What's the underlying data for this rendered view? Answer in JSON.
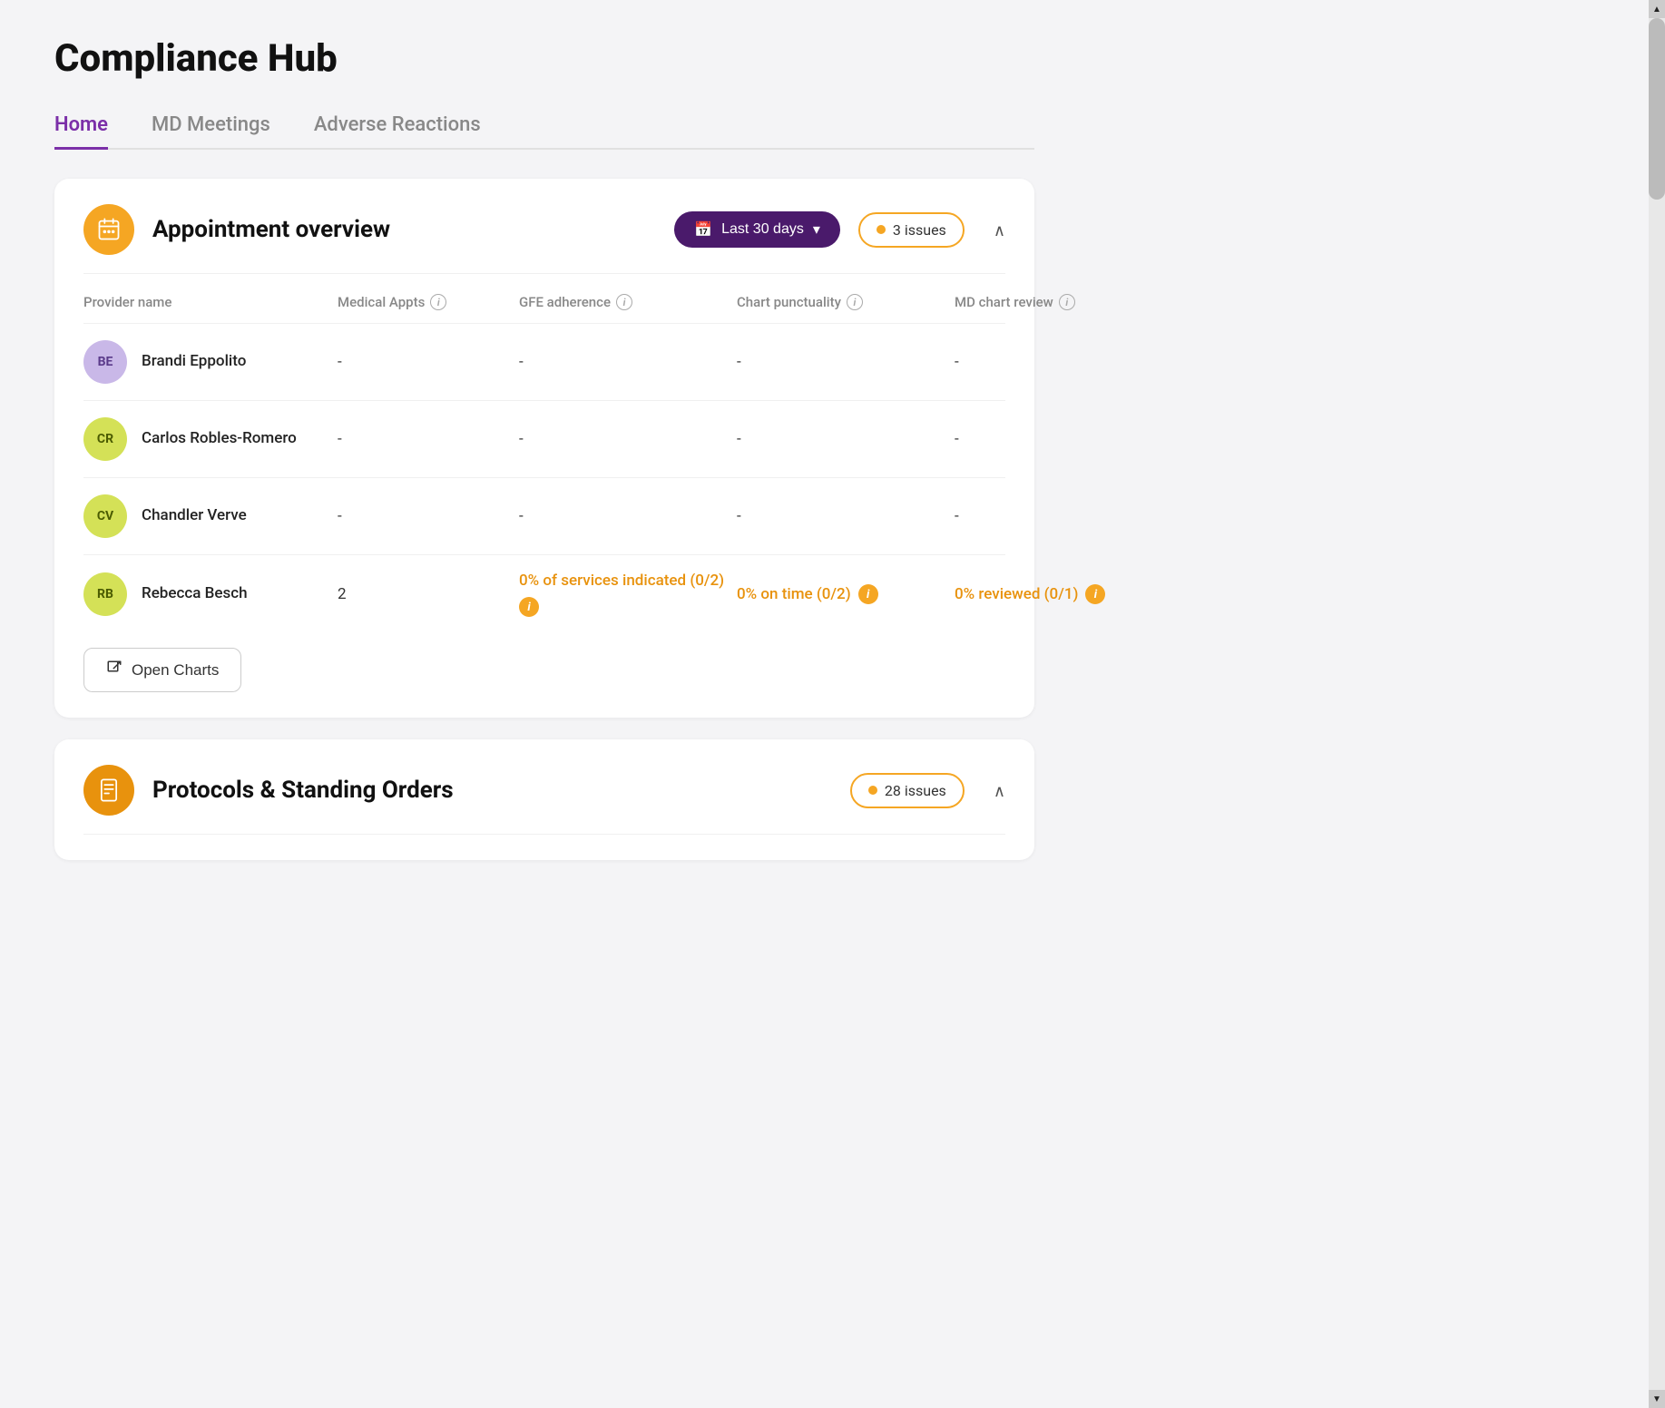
{
  "page": {
    "title": "Compliance Hub"
  },
  "tabs": [
    {
      "id": "home",
      "label": "Home",
      "active": true
    },
    {
      "id": "md-meetings",
      "label": "MD Meetings",
      "active": false
    },
    {
      "id": "adverse-reactions",
      "label": "Adverse Reactions",
      "active": false
    }
  ],
  "appointment_overview": {
    "title": "Appointment overview",
    "date_filter": "Last 30 days",
    "issues_badge": "3 issues",
    "table_headers": [
      {
        "id": "provider-name",
        "label": "Provider name",
        "has_info": false
      },
      {
        "id": "medical-appts",
        "label": "Medical Appts",
        "has_info": true
      },
      {
        "id": "gfe-adherence",
        "label": "GFE adherence",
        "has_info": true
      },
      {
        "id": "chart-punctuality",
        "label": "Chart punctuality",
        "has_info": true
      },
      {
        "id": "md-chart-review",
        "label": "MD chart review",
        "has_info": true
      }
    ],
    "rows": [
      {
        "initials": "BE",
        "avatar_class": "purple-light",
        "name": "Brandi Eppolito",
        "medical_appts": "-",
        "gfe_adherence": "-",
        "chart_punctuality": "-",
        "md_chart_review": "-",
        "has_warning": false
      },
      {
        "initials": "CR",
        "avatar_class": "yellow-green",
        "name": "Carlos Robles-Romero",
        "medical_appts": "-",
        "gfe_adherence": "-",
        "chart_punctuality": "-",
        "md_chart_review": "-",
        "has_warning": false
      },
      {
        "initials": "CV",
        "avatar_class": "yellow-green2",
        "name": "Chandler Verve",
        "medical_appts": "-",
        "gfe_adherence": "-",
        "chart_punctuality": "-",
        "md_chart_review": "-",
        "has_warning": false
      },
      {
        "initials": "RB",
        "avatar_class": "yellow-green3",
        "name": "Rebecca Besch",
        "medical_appts": "2",
        "gfe_adherence": "0% of services indicated (0/2)",
        "chart_punctuality": "0% on time (0/2)",
        "md_chart_review": "0% reviewed (0/1)",
        "has_warning": true
      }
    ],
    "open_charts_label": "Open Charts"
  },
  "protocols": {
    "title": "Protocols & Standing Orders",
    "issues_badge": "28 issues"
  },
  "icons": {
    "calendar": "📅",
    "chevron_down": "▾",
    "chevron_up": "∧",
    "external_link": "⬕",
    "clipboard": "📋",
    "appointments": "📊",
    "info": "i"
  }
}
